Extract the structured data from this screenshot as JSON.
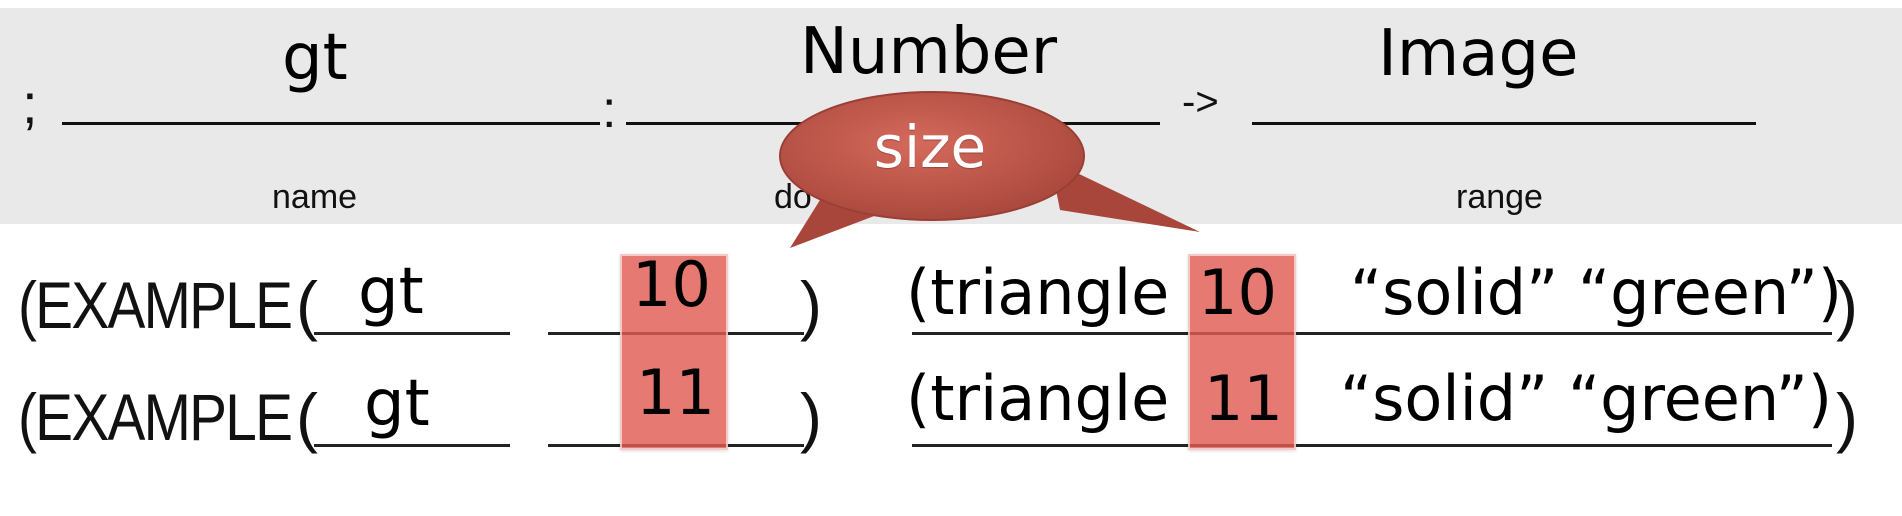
{
  "signature": {
    "prefix": ";",
    "name_value": "gt",
    "colon": ":",
    "domain_value": "Number",
    "arrow": "->",
    "range_value": "Image",
    "name_caption": "name",
    "domain_caption": "do",
    "range_caption": "range"
  },
  "callout": {
    "label": "size",
    "color": "#c0564a"
  },
  "examples": [
    {
      "keyword": "(EXAMPLE",
      "open_paren": "(",
      "fn": "gt",
      "arg": "10",
      "close_paren": ")",
      "result_prefix": "(triangle",
      "result_arg": "10",
      "result_rest": "“solid” “green”)",
      "outer_close": ")"
    },
    {
      "keyword": "(EXAMPLE",
      "open_paren": "(",
      "fn": "gt",
      "arg": "11",
      "close_paren": ")",
      "result_prefix": "(triangle",
      "result_arg": "11",
      "result_rest": "“solid” “green”)",
      "outer_close": ")"
    }
  ],
  "colors": {
    "band": "#e9e9e9",
    "highlight": "#e25c54"
  }
}
